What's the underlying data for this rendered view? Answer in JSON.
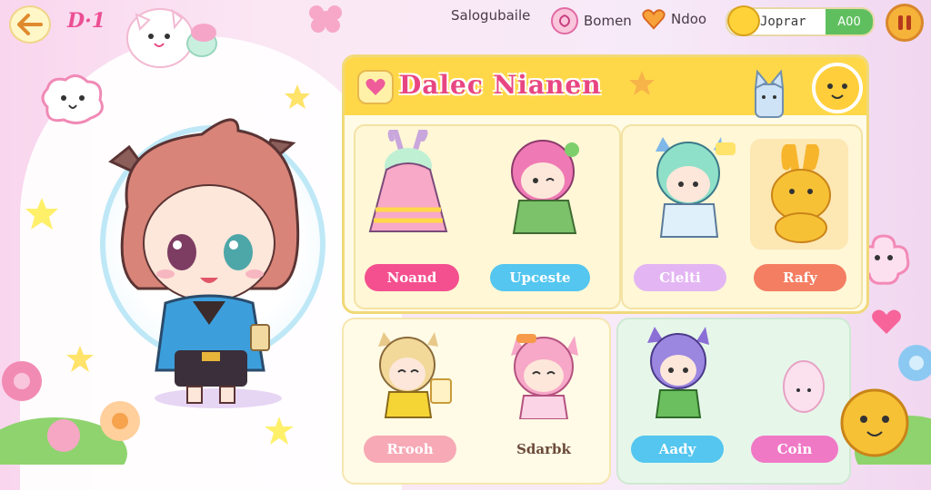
{
  "hud": {
    "level_label": "D·1",
    "nav": [
      {
        "label": "Salogubaile",
        "icon": "book-icon"
      },
      {
        "label": "Bomen",
        "icon": "shield-icon"
      },
      {
        "label": "Ndoo",
        "icon": "heart-icon"
      }
    ],
    "currency": {
      "label": "Joprar",
      "value": "A00"
    }
  },
  "panel": {
    "title": "Dalec Nianen",
    "row1": {
      "cards": [
        {
          "name": "bunny-dress"
        },
        {
          "name": "pink-hair-girl"
        },
        {
          "name": "blue-cat-girl"
        },
        {
          "name": "yellow-bunny"
        }
      ],
      "buttons": [
        {
          "label": "Noand",
          "color": "#f4508f",
          "text": "#ffffff"
        },
        {
          "label": "Upceste",
          "color": "#54c6ef",
          "text": "#ffffff"
        },
        {
          "label": "Clelti",
          "color": "#e3b6f3",
          "text": "#ffffff"
        },
        {
          "label": "Rafy",
          "color": "#f47e62",
          "text": "#ffffff"
        }
      ]
    },
    "row2": {
      "buttons": [
        {
          "label": "Rrooh",
          "color": "#f7a9b6",
          "text": "#ffffff"
        },
        {
          "label": "Sdarbk",
          "color": "transparent",
          "text": "#6b4a3a"
        },
        {
          "label": "Aady",
          "color": "#54c6ef",
          "text": "#ffffff"
        },
        {
          "label": "Coin",
          "color": "#f079c6",
          "text": "#ffffff"
        }
      ]
    }
  },
  "colors": {
    "accent": "#e84682",
    "panel_header": "#ffd84a"
  }
}
